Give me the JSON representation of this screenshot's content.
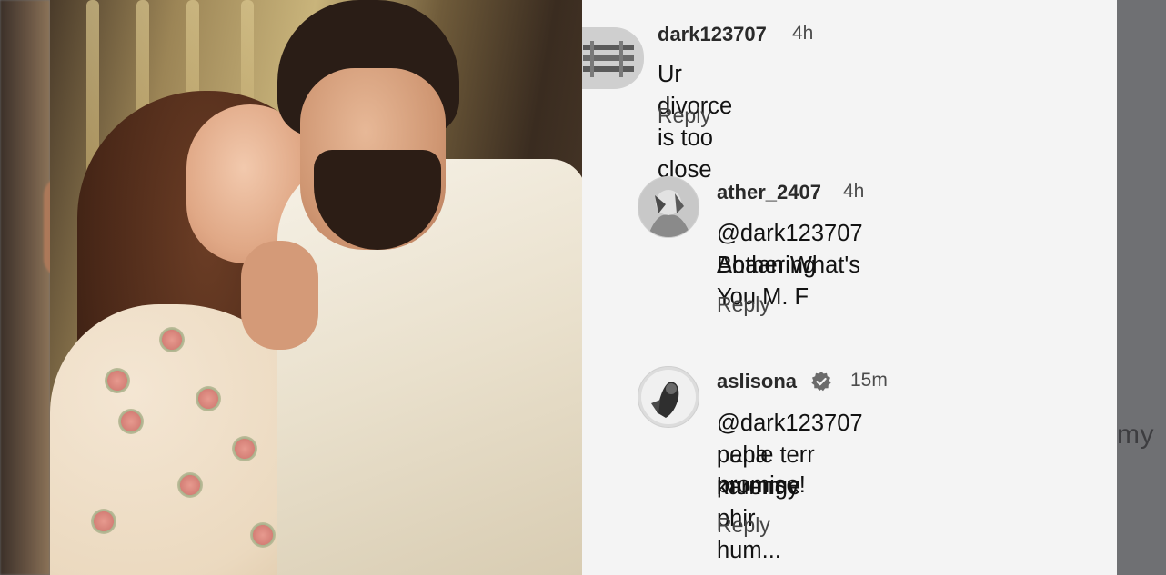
{
  "photo": {
    "description_icon": "couple-photo"
  },
  "comments": [
    {
      "username": "dark123707",
      "time": "4h",
      "text": "Ur divorce is too close to u",
      "reply_label": "Reply",
      "avatar_icon": "user-avatar-icon"
    },
    {
      "username": "ather_2407",
      "time": "4h",
      "text_line1": "@dark123707 Ahaan What's",
      "text_line2": "Bothering You M. F",
      "reply_label": "Reply",
      "avatar_icon": "user-avatar-icon"
    },
    {
      "username": "aslisona",
      "verified": true,
      "time": "15m",
      "text_line1": "@dark123707 pehle terr mummy",
      "text_line2": "papa karenge phir hum...",
      "text_line3": "promise!",
      "reply_label": "Reply",
      "avatar_icon": "user-avatar-icon"
    }
  ],
  "edge_text": "my",
  "colors": {
    "panel_bg": "#f4f4f4",
    "text": "#121212",
    "muted": "#454545"
  }
}
